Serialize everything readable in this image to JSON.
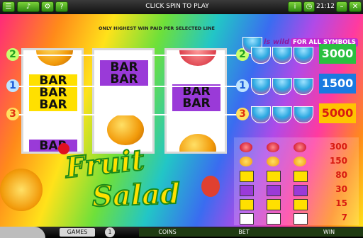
{
  "topbar": {
    "message": "CLICK SPIN TO PLAY",
    "clock": "21:12"
  },
  "play": {
    "top_note": "ONLY HIGHEST WIN PAID PER SELECTED LINE",
    "reels": [
      {
        "symbols": [
          "orange",
          "BAR BAR BAR",
          "BAR"
        ]
      },
      {
        "symbols": [
          "BAR BAR",
          "orange"
        ]
      },
      {
        "symbols": [
          "cherry",
          "BAR BAR",
          "orange"
        ]
      }
    ],
    "paylines": [
      {
        "number": "2",
        "win_value": "3000"
      },
      {
        "number": "1",
        "win_value": "1500"
      },
      {
        "number": "3",
        "win_value": "5000"
      }
    ],
    "wild_banner": {
      "text": "is wild",
      "sub": "FOR ALL SYMBOLS"
    },
    "paytable": [
      {
        "symbol": "cherry",
        "value": "300"
      },
      {
        "symbol": "orange",
        "value": "150"
      },
      {
        "symbol": "triple-bar",
        "value": "80"
      },
      {
        "symbol": "double-bar",
        "value": "30"
      },
      {
        "symbol": "single-bar",
        "value": "15"
      },
      {
        "symbol": "any-bar",
        "value": "7"
      }
    ],
    "logo": {
      "word1": "Fruit",
      "word2": "Salad"
    }
  },
  "bottombar": {
    "games_label": "GAMES",
    "coins_label": "COINS",
    "bet_label": "BET",
    "win_label": "WIN"
  },
  "colors": {
    "accent_green": "#2ac040",
    "accent_blue": "#1a7ae0",
    "accent_yellow": "#ffc400"
  }
}
